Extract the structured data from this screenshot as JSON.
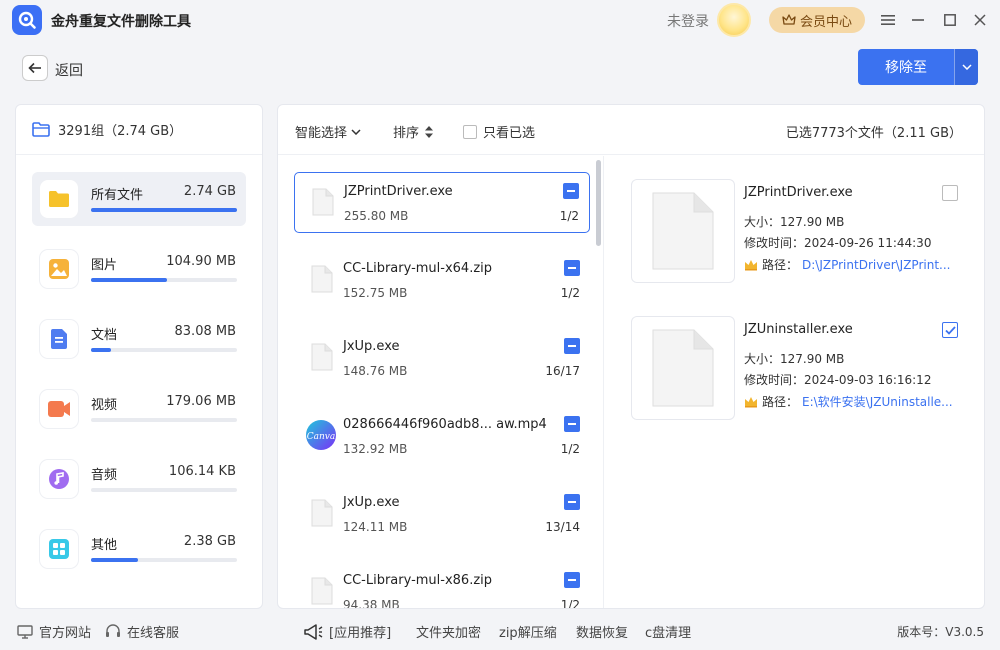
{
  "app": {
    "title": "金舟重复文件删除工具",
    "login": "未登录",
    "vip": "会员中心"
  },
  "toolbar": {
    "back": "返回",
    "move": "移除至"
  },
  "left": {
    "group_summary": "3291组（2.74 GB）",
    "categories": [
      {
        "name": "所有文件",
        "size": "2.74 GB",
        "fill": 1.0,
        "icon": "folder-icon",
        "color": "#f6c22b"
      },
      {
        "name": "图片",
        "size": "104.90 MB",
        "fill": 0.52,
        "icon": "image-icon",
        "color": "#f6b23a"
      },
      {
        "name": "文档",
        "size": "83.08 MB",
        "fill": 0.14,
        "icon": "document-icon",
        "color": "#4f7cf0"
      },
      {
        "name": "视频",
        "size": "179.06 MB",
        "fill": 0.0,
        "icon": "video-icon",
        "color": "#f47a4e"
      },
      {
        "name": "音频",
        "size": "106.14 KB",
        "fill": 0.0,
        "icon": "audio-icon",
        "color": "#a06cf0"
      },
      {
        "name": "其他",
        "size": "2.38 GB",
        "fill": 0.32,
        "icon": "apps-icon",
        "color": "#38c9e8"
      }
    ]
  },
  "main": {
    "smart_select": "智能选择",
    "sort": "排序",
    "only_selected": "只看已选",
    "selected_summary": "已选7773个文件（2.11 GB）",
    "files": [
      {
        "name": "JZPrintDriver.exe",
        "size": "255.80 MB",
        "count": "1/2",
        "icon": "file-icon"
      },
      {
        "name": "CC-Library-mul-x64.zip",
        "size": "152.75 MB",
        "count": "1/2",
        "icon": "file-icon"
      },
      {
        "name": "JxUp.exe",
        "size": "148.76 MB",
        "count": "16/17",
        "icon": "file-icon"
      },
      {
        "name": "028666446f960adb8... aw.mp4",
        "size": "132.92 MB",
        "count": "1/2",
        "icon": "canva-icon"
      },
      {
        "name": "JxUp.exe",
        "size": "124.11 MB",
        "count": "13/14",
        "icon": "file-icon"
      },
      {
        "name": "CC-Library-mul-x86.zip",
        "size": "94.38 MB",
        "count": "1/2",
        "icon": "file-icon"
      }
    ],
    "details": [
      {
        "name": "JZPrintDriver.exe",
        "size": "大小：127.90 MB",
        "modified": "修改时间：2024-09-26 11:44:30",
        "path_label": "路径：",
        "path": "D:\\JZPrintDriver\\JZPrint...",
        "checked": false
      },
      {
        "name": "JZUninstaller.exe",
        "size": "大小：127.90 MB",
        "modified": "修改时间：2024-09-03 16:16:12",
        "path_label": "路径：",
        "path": "E:\\软件安装\\JZUninstalle...",
        "checked": true
      }
    ]
  },
  "footer": {
    "website": "官方网站",
    "service": "在线客服",
    "recommend": "[应用推荐]",
    "links": [
      "文件夹加密",
      "zip解压缩",
      "数据恢复",
      "c盘清理"
    ],
    "version": "版本号：V3.0.5"
  },
  "colors": {
    "accent": "#3b72f0",
    "vip_bg": "#f5d8a6"
  }
}
